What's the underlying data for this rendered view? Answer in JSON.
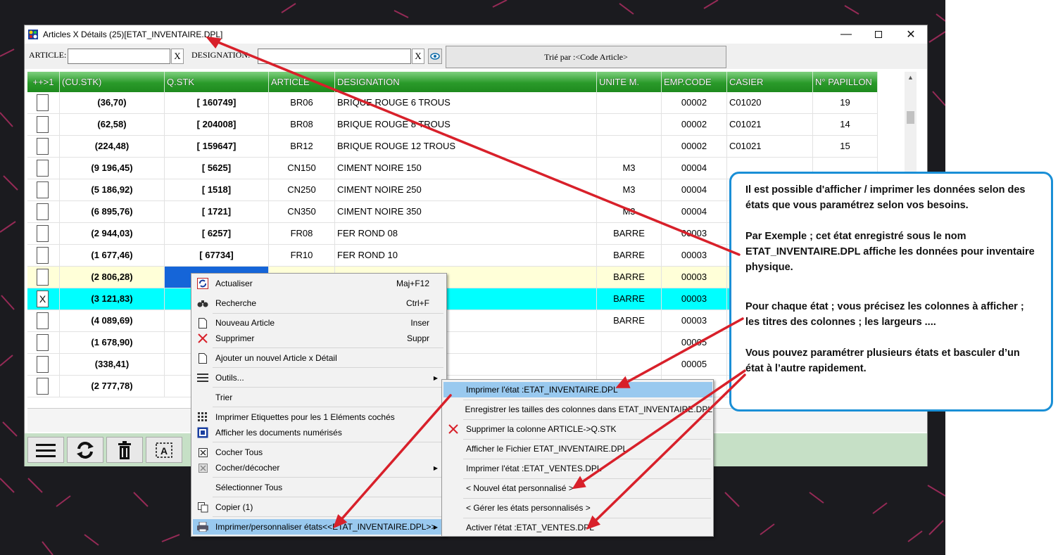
{
  "window": {
    "title": "Articles X Détails (25)[ETAT_INVENTAIRE.DPL]",
    "minimize_icon": "minimize-icon",
    "maximize_icon": "maximize-icon",
    "close_icon": "close-icon"
  },
  "search": {
    "article_label": "ARTICLE:",
    "article_value": "",
    "designation_label": "DESIGNATION:",
    "designation_value": "",
    "clear_label": "X",
    "sort_label": "Trié par :<Code Article>"
  },
  "grid": {
    "columns": [
      "++>1",
      "(CU.STK)",
      "Q.STK",
      "ARTICLE",
      "DESIGNATION",
      "UNITE M.",
      "EMP.CODE",
      "CASIER",
      "N° PAPILLON"
    ],
    "rows": [
      {
        "checked": "",
        "cu": "(36,70)",
        "qstk": "[ 160749]",
        "article": "BR06",
        "designation": "BRIQUE ROUGE 6 TROUS",
        "unite": "",
        "emp": "00002",
        "casier": "C01020",
        "papillon": "19"
      },
      {
        "checked": "",
        "cu": "(62,58)",
        "qstk": "[ 204008]",
        "article": "BR08",
        "designation": "BRIQUE ROUGE 8 TROUS",
        "unite": "",
        "emp": "00002",
        "casier": "C01021",
        "papillon": "14"
      },
      {
        "checked": "",
        "cu": "(224,48)",
        "qstk": "[ 159647]",
        "article": "BR12",
        "designation": "BRIQUE ROUGE 12 TROUS",
        "unite": "",
        "emp": "00002",
        "casier": "C01021",
        "papillon": "15"
      },
      {
        "checked": "",
        "cu": "(9 196,45)",
        "qstk": "[ 5625]",
        "article": "CN150",
        "designation": "CIMENT NOIRE 150",
        "unite": "M3",
        "emp": "00004",
        "casier": "",
        "papillon": ""
      },
      {
        "checked": "",
        "cu": "(5 186,92)",
        "qstk": "[ 1518]",
        "article": "CN250",
        "designation": "CIMENT NOIRE 250",
        "unite": "M3",
        "emp": "00004",
        "casier": "",
        "papillon": ""
      },
      {
        "checked": "",
        "cu": "(6 895,76)",
        "qstk": "[ 1721]",
        "article": "CN350",
        "designation": "CIMENT NOIRE 350",
        "unite": "M3",
        "emp": "00004",
        "casier": "",
        "papillon": ""
      },
      {
        "checked": "",
        "cu": "(2 944,03)",
        "qstk": "[ 6257]",
        "article": "FR08",
        "designation": "FER ROND 08",
        "unite": "BARRE",
        "emp": "00003",
        "casier": "",
        "papillon": ""
      },
      {
        "checked": "",
        "cu": "(1 677,46)",
        "qstk": "[ 67734]",
        "article": "FR10",
        "designation": "FER ROND 10",
        "unite": "BARRE",
        "emp": "00003",
        "casier": "",
        "papillon": ""
      },
      {
        "checked": "",
        "cu": "(2 806,28)",
        "qstk": "",
        "article": "",
        "designation": "",
        "unite": "BARRE",
        "emp": "00003",
        "casier": "",
        "papillon": ""
      },
      {
        "checked": "X",
        "cu": "(3 121,83)",
        "qstk": "",
        "article": "",
        "designation": "",
        "unite": "BARRE",
        "emp": "00003",
        "casier": "",
        "papillon": ""
      },
      {
        "checked": "",
        "cu": "(4 089,69)",
        "qstk": "",
        "article": "",
        "designation": "",
        "unite": "BARRE",
        "emp": "00003",
        "casier": "",
        "papillon": ""
      },
      {
        "checked": "",
        "cu": "(1 678,90)",
        "qstk": "",
        "article": "",
        "designation": "",
        "unite": "",
        "emp": "00005",
        "casier": "",
        "papillon": ""
      },
      {
        "checked": "",
        "cu": "(338,41)",
        "qstk": "",
        "article": "",
        "designation": "",
        "unite": "",
        "emp": "00005",
        "casier": "",
        "papillon": ""
      },
      {
        "checked": "",
        "cu": "(2 777,78)",
        "qstk": "",
        "article": "",
        "designation": "",
        "unite": "",
        "emp": "",
        "casier": "",
        "papillon": ""
      }
    ]
  },
  "toolbar": {
    "buttons": [
      "menu-icon",
      "refresh-icon",
      "trash-icon",
      "label-print-icon"
    ]
  },
  "context_menu": {
    "items": [
      {
        "label": "Actualiser",
        "shortcut": "Maj+F12",
        "icon": "refresh-icon"
      },
      {
        "label": "Recherche",
        "shortcut": "Ctrl+F",
        "icon": "binoculars-icon"
      },
      {
        "label": "Nouveau Article",
        "shortcut": "Inser",
        "icon": "new-document-icon"
      },
      {
        "label": "Supprimer",
        "shortcut": "Suppr",
        "icon": "delete-x-icon"
      },
      {
        "label": "Ajouter un nouvel Article x Détail",
        "shortcut": "",
        "icon": "new-document-icon"
      },
      {
        "label": "Outils...",
        "shortcut": "",
        "icon": "tools-icon"
      },
      {
        "label": "Trier",
        "shortcut": "",
        "icon": ""
      },
      {
        "label": "Imprimer Etiquettes pour les 1 Eléments cochés",
        "shortcut": "",
        "icon": "grid-icon"
      },
      {
        "label": "Afficher les documents numérisés",
        "shortcut": "",
        "icon": "scanned-docs-icon"
      },
      {
        "label": "Cocher Tous",
        "shortcut": "",
        "icon": "checkbox-icon"
      },
      {
        "label": "Cocher/décocher",
        "shortcut": "",
        "icon": "checkbox-toggle-icon"
      },
      {
        "label": "Sélectionner Tous",
        "shortcut": "",
        "icon": ""
      },
      {
        "label": "Copier (1)",
        "shortcut": "",
        "icon": "copy-icon"
      },
      {
        "label": "Imprimer/personnaliser états<<ETAT_INVENTAIRE.DPL>>",
        "shortcut": "",
        "icon": "printer-icon"
      }
    ]
  },
  "submenu": {
    "items": [
      {
        "label": "Imprimer l'état :ETAT_INVENTAIRE.DPL",
        "icon": ""
      },
      {
        "label": "Enregistrer les tailles des colonnes dans ETAT_INVENTAIRE.DPL",
        "icon": ""
      },
      {
        "label": "Supprimer la colonne ARTICLE->Q.STK",
        "icon": "delete-x-icon"
      },
      {
        "label": "Afficher le Fichier ETAT_INVENTAIRE.DPL",
        "icon": ""
      },
      {
        "label": "Imprimer l'état :ETAT_VENTES.DPL",
        "icon": ""
      },
      {
        "label": "< Nouvel état personnalisé >",
        "icon": ""
      },
      {
        "label": "< Gérer les états personnalisés >",
        "icon": ""
      },
      {
        "label": "Activer l'état :ETAT_VENTES.DPL",
        "icon": ""
      }
    ]
  },
  "callout": {
    "p1": "Il est possible d'afficher / imprimer les données selon des états que vous paramétrez selon vos besoins.",
    "p2": "Par Exemple ; cet état enregistré sous le nom ETAT_INVENTAIRE.DPL affiche les données pour inventaire physique.",
    "p3": "Pour chaque état ; vous précisez les colonnes à afficher ; les titres des colonnes ; les largeurs  ....",
    "p4": "Vous pouvez paramétrer plusieurs états et basculer d’un état à l’autre rapidement."
  },
  "colors": {
    "header_green": "#2a9a2a",
    "current_row": "#00ffff",
    "selected_row": "#ffffd8",
    "menu_highlight": "#99c9ef",
    "callout_border": "#1a8fd6",
    "arrow_red": "#d8202a"
  }
}
